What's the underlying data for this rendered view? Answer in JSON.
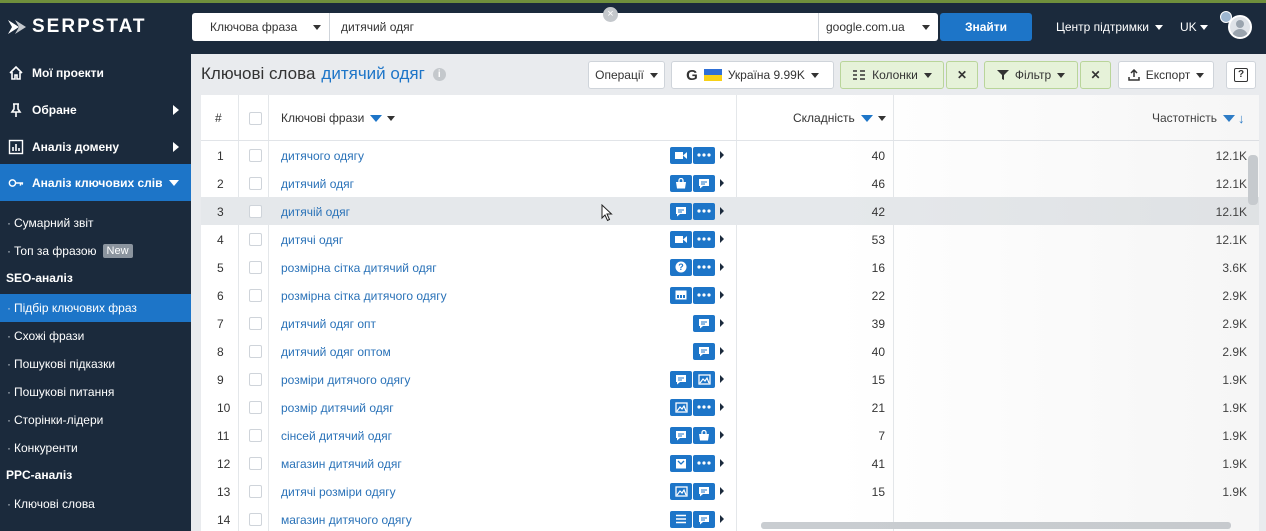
{
  "app": {
    "logo_text": "SERPSTAT"
  },
  "search": {
    "type_label": "Ключова фраза",
    "query": "дитячий одяг",
    "database": "google.com.ua",
    "button_label": "Знайти"
  },
  "header": {
    "support_label": "Центр підтримки",
    "language": "UK"
  },
  "sidebar": {
    "main_items": [
      {
        "label": "Мої проекти",
        "icon": "home-icon"
      },
      {
        "label": "Обране",
        "icon": "pin-icon"
      },
      {
        "label": "Аналіз домену",
        "icon": "chart-icon"
      },
      {
        "label": "Аналіз ключових слів",
        "icon": "key-icon"
      }
    ],
    "sub_items_top": [
      {
        "label": "Сумарний звіт"
      },
      {
        "label": "Топ за фразою",
        "badge": "New"
      }
    ],
    "section_seo": "SEO-аналіз",
    "seo_items": [
      {
        "label": "Підбір ключових фраз"
      },
      {
        "label": "Схожі фрази"
      },
      {
        "label": "Пошукові підказки"
      },
      {
        "label": "Пошукові питання"
      },
      {
        "label": "Сторінки-лідери"
      },
      {
        "label": "Конкуренти"
      }
    ],
    "section_ppc": "PPC-аналіз",
    "ppc_items": [
      {
        "label": "Ключові слова"
      }
    ]
  },
  "page": {
    "title": "Ключові слова",
    "keyword": "дитячий одяг",
    "toolbar": {
      "operations": "Операції",
      "google_letter": "G",
      "region": "Україна 9.99K",
      "columns": "Колонки",
      "filter": "Фільтр",
      "export": "Експорт",
      "help": "?"
    }
  },
  "table": {
    "headers": {
      "num": "#",
      "keyword": "Ключові фрази",
      "difficulty": "Складність",
      "frequency": "Частотність"
    },
    "rows": [
      {
        "n": "1",
        "kw": "дитячого одягу",
        "diff": "40",
        "freq": "12.1K",
        "features": [
          "video",
          "dots"
        ]
      },
      {
        "n": "2",
        "kw": "дитячий одяг",
        "diff": "46",
        "freq": "12.1K",
        "features": [
          "bag",
          "chat"
        ]
      },
      {
        "n": "3",
        "kw": "дитячій одяг",
        "diff": "42",
        "freq": "12.1K",
        "features": [
          "chat",
          "dots"
        ]
      },
      {
        "n": "4",
        "kw": "дитячі одяг",
        "diff": "53",
        "freq": "12.1K",
        "features": [
          "video",
          "dots"
        ]
      },
      {
        "n": "5",
        "kw": "розмірна сітка дитячий одяг",
        "diff": "16",
        "freq": "3.6K",
        "features": [
          "question",
          "dots"
        ]
      },
      {
        "n": "6",
        "kw": "розмірна сітка дитячого одягу",
        "diff": "22",
        "freq": "2.9K",
        "features": [
          "image",
          "dots"
        ]
      },
      {
        "n": "7",
        "kw": "дитячий одяг опт",
        "diff": "39",
        "freq": "2.9K",
        "features": [
          "chat"
        ]
      },
      {
        "n": "8",
        "kw": "дитячий одяг оптом",
        "diff": "40",
        "freq": "2.9K",
        "features": [
          "chat"
        ]
      },
      {
        "n": "9",
        "kw": "розміри дитячого одягу",
        "diff": "15",
        "freq": "1.9K",
        "features": [
          "chat",
          "gallery"
        ]
      },
      {
        "n": "10",
        "kw": "розмір дитячий одяг",
        "diff": "21",
        "freq": "1.9K",
        "features": [
          "gallery",
          "dots"
        ]
      },
      {
        "n": "11",
        "kw": "сінсей дитячий одяг",
        "diff": "7",
        "freq": "1.9K",
        "features": [
          "chat",
          "bag"
        ]
      },
      {
        "n": "12",
        "kw": "магазин дитячий одяг",
        "diff": "41",
        "freq": "1.9K",
        "features": [
          "shop",
          "dots"
        ]
      },
      {
        "n": "13",
        "kw": "дитячі розміри одягу",
        "diff": "15",
        "freq": "1.9K",
        "features": [
          "gallery",
          "chat"
        ]
      },
      {
        "n": "14",
        "kw": "магазин дитячого одягу",
        "diff": "",
        "freq": "",
        "features": [
          "list",
          "chat"
        ]
      }
    ]
  },
  "colors": {
    "nav_bg": "#1b2a3c",
    "accent": "#1d75c8",
    "green_btn": "#e6f2d9",
    "link": "#2a72b8"
  }
}
